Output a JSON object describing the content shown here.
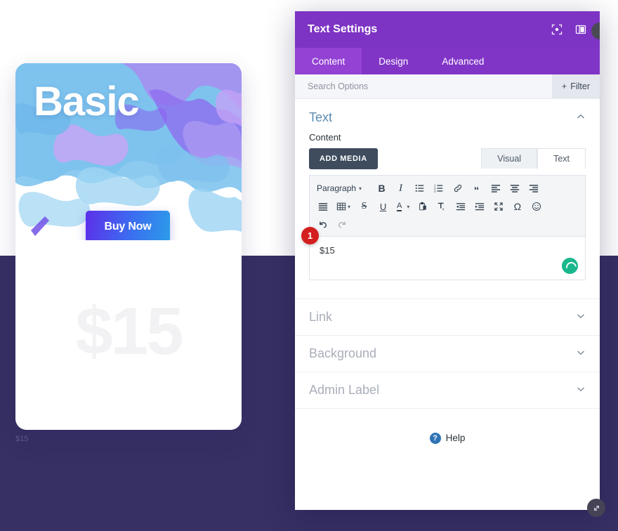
{
  "page": {
    "background_color": "#363064",
    "top_background_color": "#ffffff"
  },
  "pricing_card": {
    "plan_title": "Basic",
    "buy_button_label": "Buy Now",
    "price_display": "$15",
    "caption_below_card": "$15",
    "accent_gradient_from": "#5d2fe9",
    "accent_gradient_to": "#2b9ce9"
  },
  "modal": {
    "title": "Text Settings",
    "header_color": "#7d33c4",
    "header_icons": [
      {
        "name": "focus-icon",
        "glyph": "⬚"
      },
      {
        "name": "layout-columns-icon",
        "glyph": "▣"
      }
    ],
    "tabs": [
      {
        "label": "Content",
        "active": true
      },
      {
        "label": "Design",
        "active": false
      },
      {
        "label": "Advanced",
        "active": false
      }
    ],
    "search": {
      "placeholder": "Search Options",
      "value": ""
    },
    "filter_button": {
      "label": "Filter",
      "plus_glyph": "+"
    },
    "text_section": {
      "title": "Text",
      "collapse_chevron": "ⱏ",
      "content_label": "Content",
      "add_media_label": "ADD MEDIA",
      "editor_tabs": [
        {
          "label": "Visual",
          "active": true
        },
        {
          "label": "Text",
          "active": false
        }
      ],
      "format_select": {
        "value": "Paragraph",
        "caret": "▾"
      },
      "toolbar_row1": [
        {
          "name": "bold-icon",
          "glyph": "B"
        },
        {
          "name": "italic-icon",
          "glyph": "I"
        },
        {
          "name": "bulleted-list-icon",
          "glyph": "☰"
        },
        {
          "name": "numbered-list-icon",
          "glyph": "☰"
        },
        {
          "name": "link-icon",
          "glyph": "🔗"
        },
        {
          "name": "blockquote-icon",
          "glyph": "“"
        },
        {
          "name": "align-left-icon",
          "glyph": "≡"
        },
        {
          "name": "align-center-icon",
          "glyph": "≡"
        },
        {
          "name": "align-right-icon",
          "glyph": "≡"
        }
      ],
      "toolbar_row2": [
        {
          "name": "align-justify-icon",
          "glyph": "≡"
        },
        {
          "name": "table-icon",
          "glyph": "▦"
        },
        {
          "name": "strikethrough-icon",
          "glyph": "S"
        },
        {
          "name": "underline-icon",
          "glyph": "U"
        },
        {
          "name": "text-color-icon",
          "glyph": "A"
        },
        {
          "name": "paste-as-text-icon",
          "glyph": "📋"
        },
        {
          "name": "clear-formatting-icon",
          "glyph": "T"
        },
        {
          "name": "outdent-icon",
          "glyph": "⇤"
        },
        {
          "name": "indent-icon",
          "glyph": "⇥"
        },
        {
          "name": "fullscreen-icon",
          "glyph": "⤢"
        },
        {
          "name": "special-character-icon",
          "glyph": "Ω"
        },
        {
          "name": "emoji-icon",
          "glyph": "☺"
        }
      ],
      "toolbar_row3": [
        {
          "name": "undo-icon",
          "glyph": "↶"
        },
        {
          "name": "redo-icon",
          "glyph": "↷"
        }
      ],
      "editor_value": "$15",
      "step_badge": "1",
      "loading_indicator_color": "#1ab78d"
    },
    "accordions": [
      {
        "label": "Link",
        "chevron": "ⱟ"
      },
      {
        "label": "Background",
        "chevron": "ⱟ"
      },
      {
        "label": "Admin Label",
        "chevron": "ⱟ"
      }
    ],
    "help": {
      "label": "Help",
      "icon_glyph": "?"
    },
    "footer_buttons": [
      {
        "name": "cancel-button",
        "glyph": "✖",
        "color": "#e94f4f"
      },
      {
        "name": "undo-button",
        "glyph": "↺",
        "color": "#8e37d4"
      },
      {
        "name": "redo-button",
        "glyph": "↻",
        "color": "#2a8cd8"
      },
      {
        "name": "save-button",
        "glyph": "✔",
        "color": "#2bbf96"
      }
    ],
    "resize_handle_glyph": "⤡"
  }
}
